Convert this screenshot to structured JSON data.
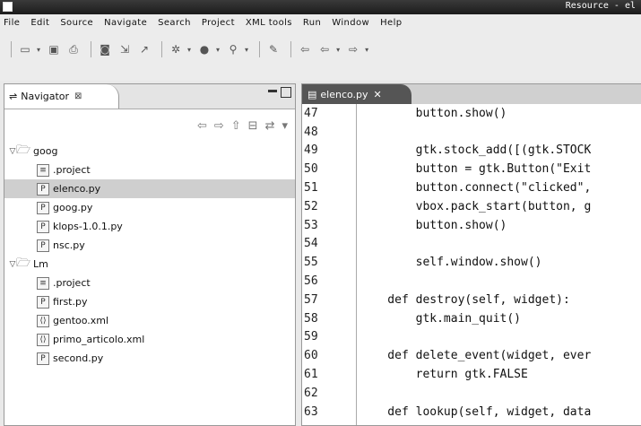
{
  "window": {
    "title": "Resource - el"
  },
  "menu": [
    "File",
    "Edit",
    "Source",
    "Navigate",
    "Search",
    "Project",
    "XML tools",
    "Run",
    "Window",
    "Help"
  ],
  "toolbar": {
    "icons": [
      "new-icon",
      "save-icon",
      "print-icon",
      "search-icon",
      "open-type-icon",
      "open-resource-icon",
      "debug-icon",
      "run-icon",
      "external-tools-icon",
      "pin-icon",
      "back-icon",
      "forward-icon",
      "next-icon"
    ]
  },
  "navigator": {
    "tab_label": "Navigator",
    "tab_close": "⊠",
    "tree": [
      {
        "label": "goog",
        "type": "folder",
        "level": 0,
        "expanded": true
      },
      {
        "label": ".project",
        "type": "file",
        "level": 1
      },
      {
        "label": "elenco.py",
        "type": "py",
        "level": 1,
        "selected": true
      },
      {
        "label": "goog.py",
        "type": "py",
        "level": 1
      },
      {
        "label": "klops-1.0.1.py",
        "type": "py",
        "level": 1
      },
      {
        "label": "nsc.py",
        "type": "py",
        "level": 1
      },
      {
        "label": "Lm",
        "type": "folder",
        "level": 0,
        "expanded": true
      },
      {
        "label": ".project",
        "type": "file",
        "level": 1
      },
      {
        "label": "first.py",
        "type": "py",
        "level": 1
      },
      {
        "label": "gentoo.xml",
        "type": "xml",
        "level": 1
      },
      {
        "label": "primo_articolo.xml",
        "type": "xml",
        "level": 1
      },
      {
        "label": "second.py",
        "type": "py",
        "level": 1
      }
    ]
  },
  "editor": {
    "tab_label": "elenco.py",
    "lines": [
      {
        "n": "47",
        "code": "        button.show()"
      },
      {
        "n": "48",
        "code": ""
      },
      {
        "n": "49",
        "code": "        gtk.stock_add([(gtk.STOCK"
      },
      {
        "n": "50",
        "code": "        button = gtk.Button(\"Exit"
      },
      {
        "n": "51",
        "code": "        button.connect(\"clicked\","
      },
      {
        "n": "52",
        "code": "        vbox.pack_start(button, g"
      },
      {
        "n": "53",
        "code": "        button.show()"
      },
      {
        "n": "54",
        "code": ""
      },
      {
        "n": "55",
        "code": "        self.window.show()"
      },
      {
        "n": "56",
        "code": ""
      },
      {
        "n": "57",
        "code": "    def destroy(self, widget):"
      },
      {
        "n": "58",
        "code": "        gtk.main_quit()"
      },
      {
        "n": "59",
        "code": ""
      },
      {
        "n": "60",
        "code": "    def delete_event(widget, ever"
      },
      {
        "n": "61",
        "code": "        return gtk.FALSE"
      },
      {
        "n": "62",
        "code": ""
      },
      {
        "n": "63",
        "code": "    def lookup(self, widget, data"
      }
    ]
  }
}
